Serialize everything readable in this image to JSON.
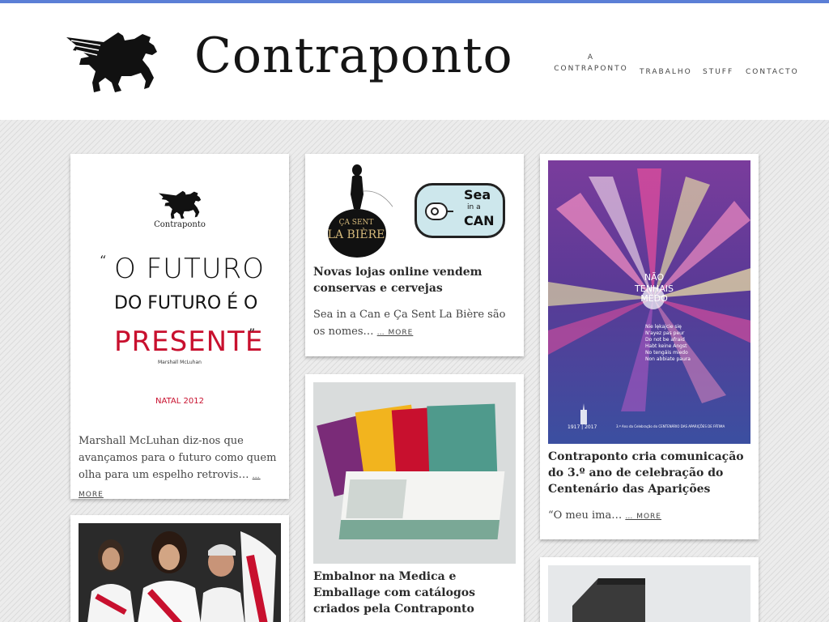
{
  "brand": {
    "title": "Contraponto"
  },
  "nav": {
    "items": [
      {
        "label": "A CONTRAPONTO"
      },
      {
        "label": "TRABALHO"
      },
      {
        "label": "STUFF"
      },
      {
        "label": "CONTACTO"
      }
    ],
    "first_line1": "A",
    "first_line2": "CONTRAPONTO"
  },
  "posts": [
    {
      "poster_brand": "Contraponto",
      "poster_line1": "O FUTURO",
      "poster_line2": "DO FUTURO É O",
      "poster_line3": "PRESENTE",
      "poster_quote_open": "“",
      "poster_quote_close": "”",
      "poster_author": "Marshall McLuhan",
      "poster_footer": "NATAL 2012",
      "excerpt": "Marshall McLuhan diz-nos que avançamos para o futuro como quem olha para um espelho retrovis…",
      "more": "… MORE"
    },
    {
      "img_left_line1": "ÇA SENT",
      "img_left_line2": "LA BIÈRE",
      "img_right_line1": "Sea",
      "img_right_line2": "in a",
      "img_right_line3": "CAN",
      "title": "Novas lojas online vendem conservas e cervejas",
      "excerpt": "Sea in a Can e Ça Sent La Bière são os nomes…",
      "more": "… MORE"
    },
    {
      "title": "Embalnor na Medica e Emballage com catálogos criados pela Contraponto"
    },
    {
      "poster_line1": "NÃO",
      "poster_line2": "TENHAIS",
      "poster_line3": "MEDO",
      "poster_translations": [
        "Nie lękajcie się",
        "N'ayez pas peur",
        "Do not be afraid",
        "Habt keine Angst",
        "No tengáis miedo",
        "Non abbiate paura"
      ],
      "poster_years": "1917 | 2017",
      "poster_caption": "3.º Ano da Celebração do CENTENÁRIO DAS APARIÇÕES DE FÁTIMA",
      "title": "Contraponto cria comunicação do 3.º ano de celebração do Centenário das Aparições",
      "excerpt": "“O meu ima…",
      "more": "… MORE"
    }
  ],
  "colors": {
    "accent": "#5b7fd6",
    "poster_red": "#c8102e",
    "poster_purple": "#6a3a9a",
    "poster_blue": "#3b4fa0"
  }
}
